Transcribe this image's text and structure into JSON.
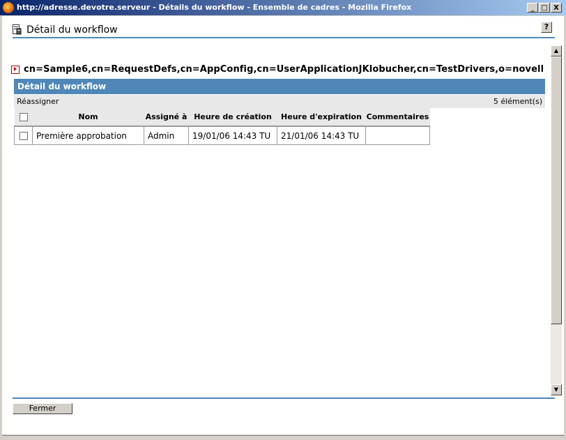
{
  "window": {
    "title": "http://adresse.devotre.serveur - Détails du workflow - Ensemble de cadres - Mozilla Firefox",
    "min_label": "_",
    "max_label": "□",
    "close_label": "X"
  },
  "page": {
    "title": "Détail du workflow",
    "help_label": "?",
    "dn": "cn=Sample6,cn=RequestDefs,cn=AppConfig,cn=UserApplicationJKlobucher,cn=TestDrivers,o=novell"
  },
  "panel": {
    "title": "Détail du workflow",
    "reassign_label": "Réassigner",
    "count_label": "5 élément(s)"
  },
  "table": {
    "headers": {
      "name": "Nom",
      "assigned": "Assigné à",
      "created": "Heure de création",
      "expires": "Heure d'expiration",
      "comments": "Commentaires"
    },
    "rows": [
      {
        "name": "Première approbation",
        "assigned": "Admin",
        "created": "19/01/06 14:43 TU",
        "expires": "21/01/06 14:43 TU",
        "comments": ""
      }
    ]
  },
  "footer": {
    "close_label": "Fermer"
  },
  "colors": {
    "accent": "#4f87b8",
    "titlebar_start": "#0a246a",
    "titlebar_end": "#a6caf0"
  },
  "icons": {
    "browser": "firefox-icon",
    "page": "workflow-page-icon",
    "dn": "dn-arrow-icon"
  }
}
